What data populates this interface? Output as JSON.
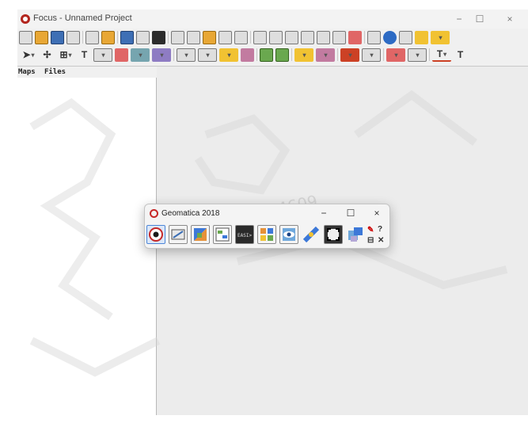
{
  "app": {
    "title": "Focus - Unnamed Project"
  },
  "window_controls": {
    "minimize": "−",
    "maximize": "☐",
    "close": "×"
  },
  "toolbar2": {
    "text_tool": "T",
    "text_tool2": "T"
  },
  "panel": {
    "tabs": [
      "Maps",
      "Files"
    ]
  },
  "watermark": {
    "text": "11834609"
  },
  "dialog": {
    "title": "Geomatica 2018",
    "minimize": "−",
    "maximize": "☐",
    "close": "×",
    "tools": [
      "focus-icon",
      "modeler-icon",
      "ortho-icon",
      "table-icon",
      "easi-icon",
      "pixel-icon",
      "vision-icon",
      "satellite-icon",
      "mosaic-icon",
      "dem-icon"
    ],
    "extra_icons": {
      "help": "?",
      "close_small": "✕"
    }
  }
}
